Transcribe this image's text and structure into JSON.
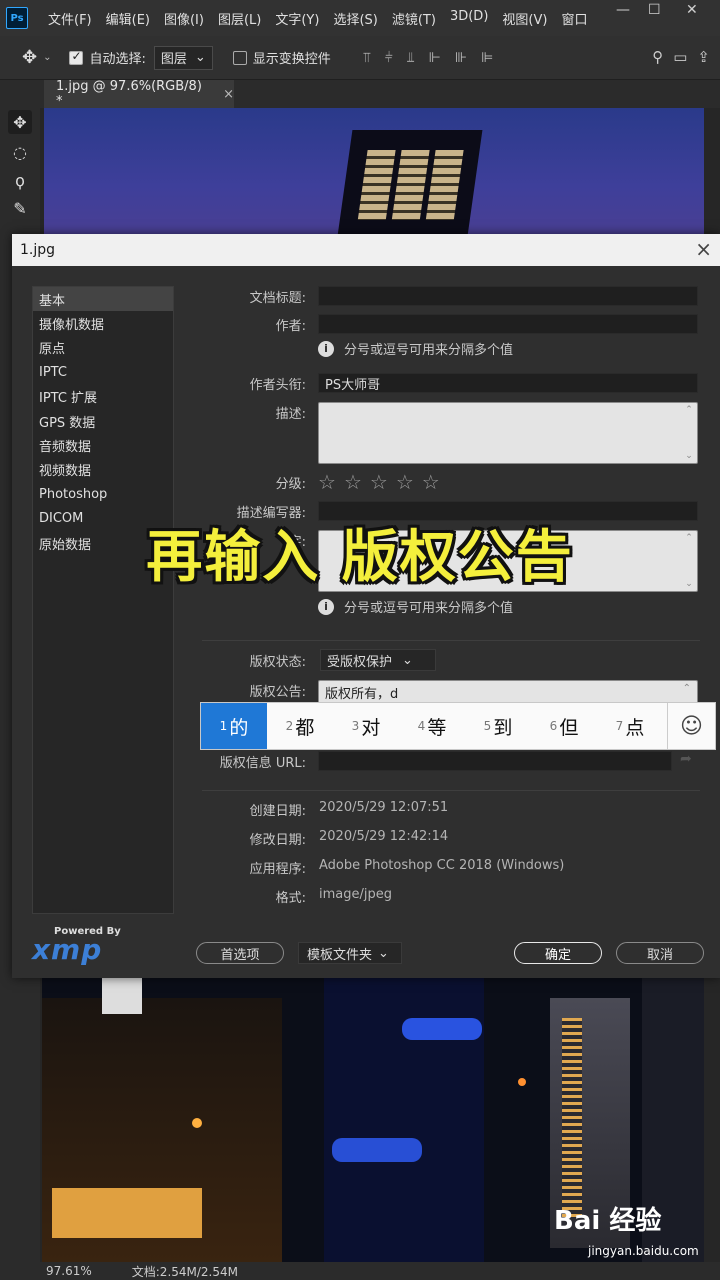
{
  "app": {
    "logo": "Ps"
  },
  "menubar": {
    "items": [
      "文件(F)",
      "编辑(E)",
      "图像(I)",
      "图层(L)",
      "文字(Y)",
      "选择(S)",
      "滤镜(T)",
      "3D(D)",
      "视图(V)",
      "窗口"
    ]
  },
  "options": {
    "auto_select_label": "自动选择:",
    "auto_select_value": "图层",
    "show_transform_label": "显示变换控件"
  },
  "document_tab": {
    "title": "1.jpg @ 97.6%(RGB/8) *",
    "close": "×"
  },
  "dialog": {
    "title": "1.jpg",
    "categories": [
      "基本",
      "摄像机数据",
      "原点",
      "IPTC",
      "IPTC 扩展",
      "GPS 数据",
      "音频数据",
      "视频数据",
      "Photoshop",
      "DICOM",
      "原始数据"
    ],
    "fields": {
      "doc_title_label": "文档标题:",
      "author_label": "作者:",
      "author_hint": "分号或逗号可用来分隔多个值",
      "author_title_label": "作者头衔:",
      "author_title_value": "PS大师哥",
      "description_label": "描述:",
      "rating_label": "分级:",
      "desc_writer_label": "描述编写器:",
      "keywords_label": "字:",
      "keywords_hint": "分号或逗号可用来分隔多个值",
      "copyright_status_label": "版权状态:",
      "copyright_status_value": "受版权保护",
      "copyright_notice_label": "版权公告:",
      "copyright_notice_value": "版权所有，d",
      "copyright_url_label": "版权信息 URL:",
      "created_label": "创建日期:",
      "created_value": "2020/5/29 12:07:51",
      "modified_label": "修改日期:",
      "modified_value": "2020/5/29 12:42:14",
      "application_label": "应用程序:",
      "application_value": "Adobe Photoshop CC 2018 (Windows)",
      "format_label": "格式:",
      "format_value": "image/jpeg"
    },
    "rating_stars": 5,
    "xmp": {
      "powered": "Powered By",
      "mark": "xmp"
    },
    "buttons": {
      "preferences": "首选项",
      "template_folder": "模板文件夹",
      "ok": "确定",
      "cancel": "取消"
    }
  },
  "caption": "再输入 版权公告",
  "ime": {
    "candidates": [
      {
        "n": "1",
        "c": "的"
      },
      {
        "n": "2",
        "c": "都"
      },
      {
        "n": "3",
        "c": "对"
      },
      {
        "n": "4",
        "c": "等"
      },
      {
        "n": "5",
        "c": "到"
      },
      {
        "n": "6",
        "c": "但"
      },
      {
        "n": "7",
        "c": "点"
      }
    ],
    "emoji": "☺"
  },
  "statusbar": {
    "zoom": "97.61%",
    "doc": "文档:2.54M/2.54M"
  },
  "watermark": {
    "brand": "Bai 经验",
    "url": "jingyan.baidu.com"
  }
}
